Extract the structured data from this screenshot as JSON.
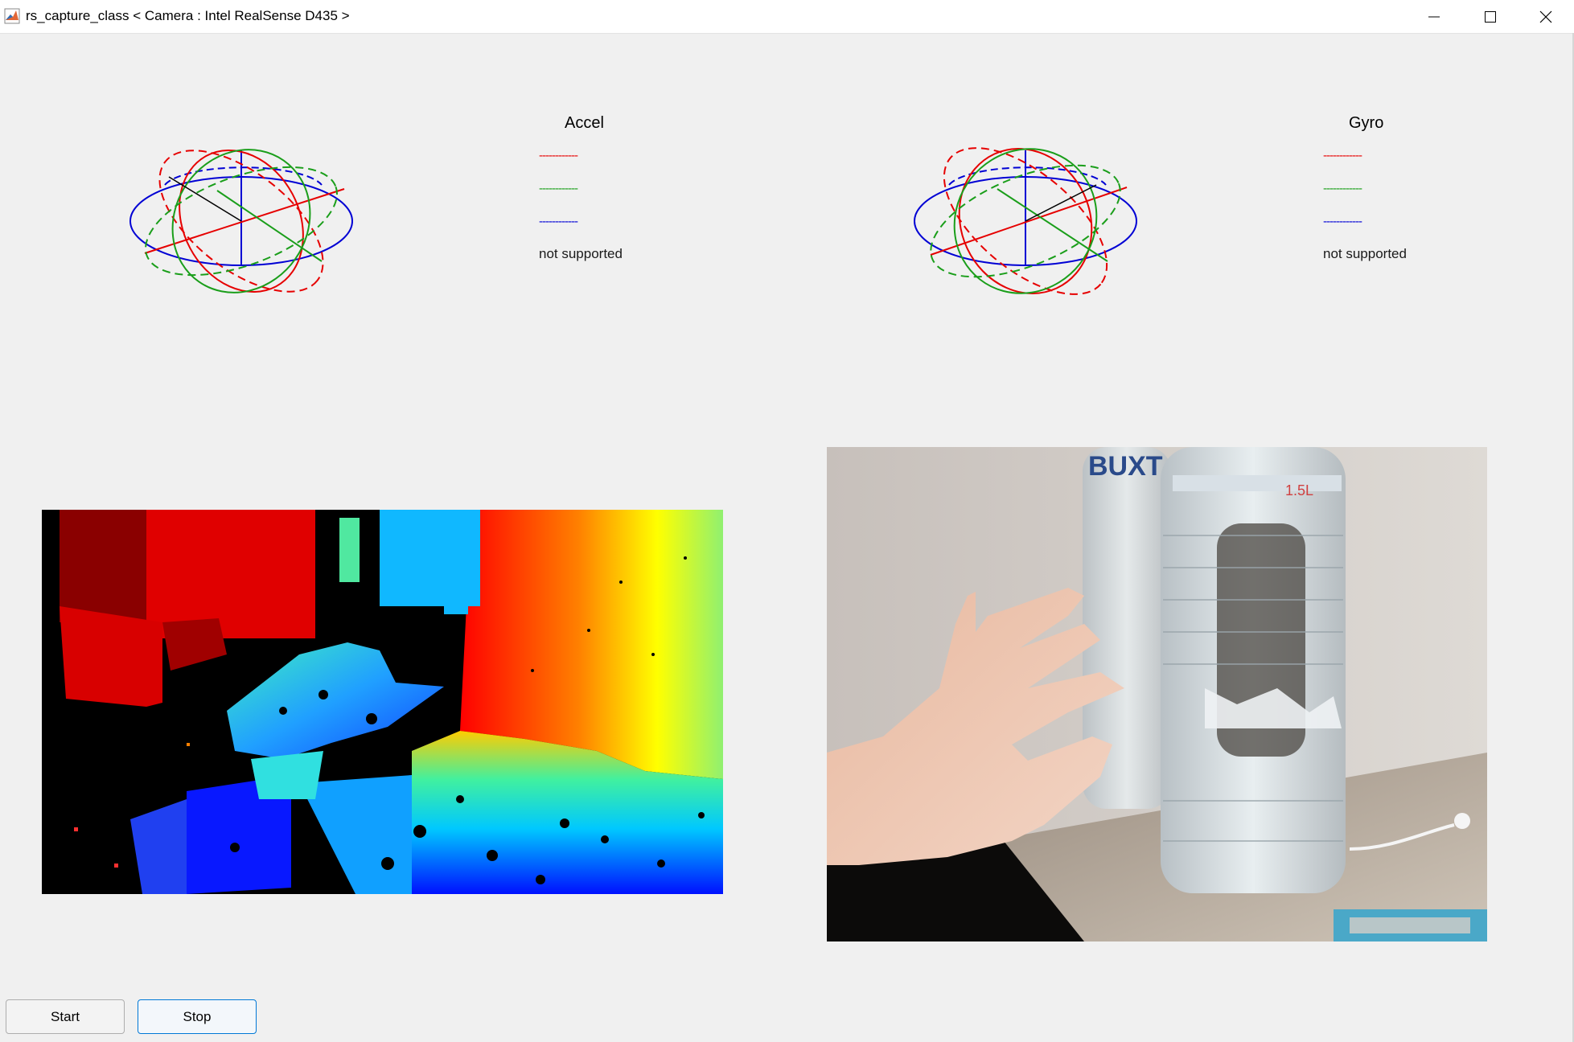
{
  "window": {
    "title": "rs_capture_class < Camera : Intel RealSense D435 >",
    "icon": "matlab-icon",
    "controls": [
      "minimize-icon",
      "maximize-icon",
      "close-icon"
    ]
  },
  "imu": {
    "accel": {
      "title": "Accel",
      "x_line": "------------",
      "y_line": "------------",
      "z_line": "------------",
      "status": "not supported"
    },
    "gyro": {
      "title": "Gyro",
      "x_line": "------------",
      "y_line": "------------",
      "z_line": "------------",
      "status": "not supported"
    }
  },
  "colors": {
    "x_axis": "#e60000",
    "y_axis": "#1a9e1a",
    "z_axis": "#0000d4",
    "background": "#f0f0f0"
  },
  "buttons": {
    "start": "Start",
    "stop": "Stop"
  }
}
